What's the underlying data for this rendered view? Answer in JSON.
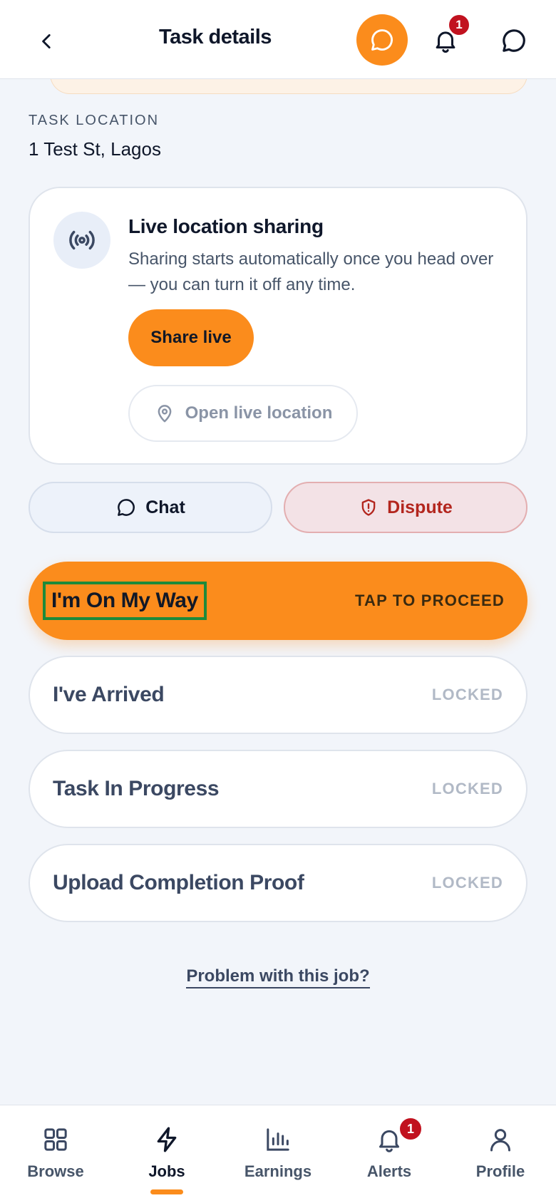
{
  "header": {
    "title": "Task details",
    "notification_count": "1"
  },
  "location": {
    "label": "TASK LOCATION",
    "value": "1 Test St, Lagos"
  },
  "live_sharing": {
    "title": "Live location sharing",
    "description": "Sharing starts automatically once you head over — you can turn it off any time.",
    "share_label": "Share live",
    "open_label": "Open live location"
  },
  "actions": {
    "chat_label": "Chat",
    "dispute_label": "Dispute"
  },
  "steps": [
    {
      "label": "I'm On My Way",
      "status": "TAP TO PROCEED"
    },
    {
      "label": "I've Arrived",
      "status": "LOCKED"
    },
    {
      "label": "Task In Progress",
      "status": "LOCKED"
    },
    {
      "label": "Upload Completion Proof",
      "status": "LOCKED"
    }
  ],
  "problem_link": "Problem with this job?",
  "nav": {
    "items": [
      {
        "label": "Browse",
        "icon": "grid-icon"
      },
      {
        "label": "Jobs",
        "icon": "lightning-icon"
      },
      {
        "label": "Earnings",
        "icon": "bar-chart-icon"
      },
      {
        "label": "Alerts",
        "icon": "bell-icon"
      },
      {
        "label": "Profile",
        "icon": "user-icon"
      }
    ],
    "active": "Jobs",
    "alerts_count": "1"
  },
  "colors": {
    "accent": "#fb8c1c",
    "danger": "#b3261e",
    "badge": "#c1121f",
    "background": "#f2f5fa"
  }
}
